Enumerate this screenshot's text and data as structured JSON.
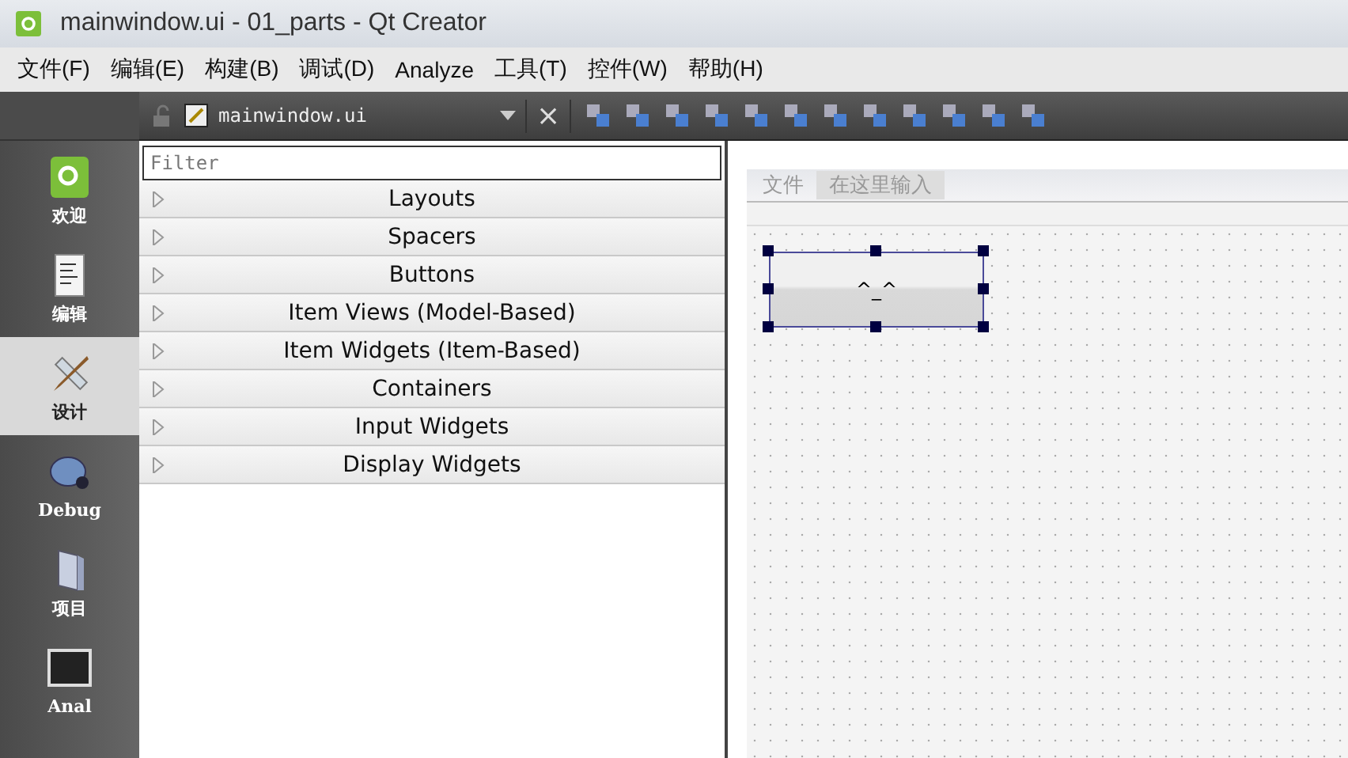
{
  "window": {
    "title": "mainwindow.ui - 01_parts - Qt Creator"
  },
  "menu_bar": [
    "文件(F)",
    "编辑(E)",
    "构建(B)",
    "调试(D)",
    "Analyze",
    "工具(T)",
    "控件(W)",
    "帮助(H)"
  ],
  "editor_toolbar": {
    "file_name": "mainwindow.ui",
    "close": "×"
  },
  "modes": [
    {
      "label": "欢迎",
      "kind": "welcome",
      "selected": false
    },
    {
      "label": "编辑",
      "kind": "edit",
      "selected": false
    },
    {
      "label": "设计",
      "kind": "design",
      "selected": true
    },
    {
      "label": "Debug",
      "kind": "debug",
      "selected": false
    },
    {
      "label": "项目",
      "kind": "projects",
      "selected": false
    },
    {
      "label": "Anal",
      "kind": "analyze",
      "selected": false
    }
  ],
  "widget_box": {
    "filter": {
      "placeholder": "Filter"
    },
    "categories": [
      {
        "label": "Layouts",
        "expanded": false
      },
      {
        "label": "Spacers",
        "expanded": false
      },
      {
        "label": "Buttons",
        "expanded": false
      },
      {
        "label": "Item Views (Model-Based)",
        "expanded": false
      },
      {
        "label": "Item Widgets (Item-Based)",
        "expanded": false
      },
      {
        "label": "Containers",
        "expanded": false
      },
      {
        "label": "Input Widgets",
        "expanded": false
      },
      {
        "label": "Display Widgets",
        "expanded": false
      }
    ]
  },
  "form": {
    "menu": [
      "文件",
      "在这里输入"
    ],
    "push_button": {
      "text": "^_^",
      "selected": true
    }
  }
}
